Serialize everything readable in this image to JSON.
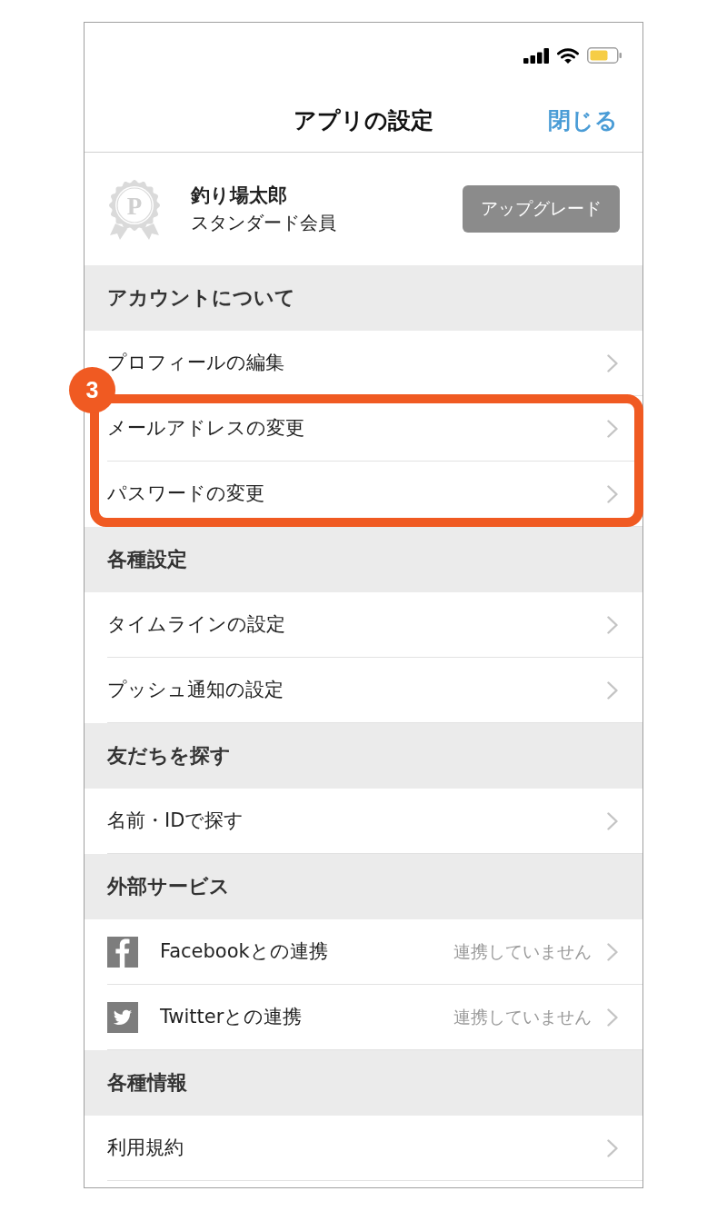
{
  "header": {
    "title": "アプリの設定",
    "close_button": "閉じる"
  },
  "profile": {
    "badge_letter": "P",
    "name": "釣り場太郎",
    "membership": "スタンダード会員",
    "upgrade_button": "アップグレード"
  },
  "sections": [
    {
      "title": "アカウントについて",
      "callout": "3",
      "rows": [
        {
          "kind": "nav",
          "label": "プロフィールの編集",
          "highlighted": false
        },
        {
          "kind": "nav",
          "label": "メールアドレスの変更",
          "highlighted": true
        },
        {
          "kind": "nav",
          "label": "パスワードの変更",
          "highlighted": true
        }
      ]
    },
    {
      "title": "各種設定",
      "rows": [
        {
          "kind": "nav",
          "label": "タイムラインの設定",
          "highlighted": false
        },
        {
          "kind": "nav",
          "label": "プッシュ通知の設定",
          "highlighted": false
        }
      ]
    },
    {
      "title": "友だちを探す",
      "rows": [
        {
          "kind": "nav",
          "label": "名前・IDで探す",
          "highlighted": false
        }
      ]
    },
    {
      "title": "外部サービス",
      "rows": [
        {
          "kind": "facebook",
          "label": "Facebookとの連携",
          "status": "連携していません",
          "highlighted": false
        },
        {
          "kind": "twitter",
          "label": "Twitterとの連携",
          "status": "連携していません",
          "highlighted": false
        }
      ]
    },
    {
      "title": "各種情報",
      "rows": [
        {
          "kind": "nav",
          "label": "利用規約",
          "highlighted": false
        }
      ]
    }
  ]
}
